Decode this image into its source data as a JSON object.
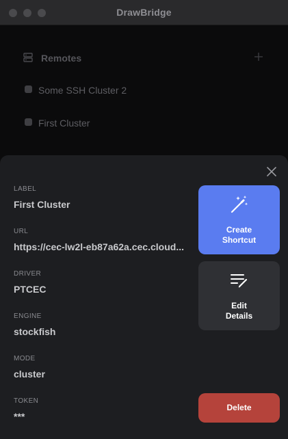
{
  "window": {
    "title": "DrawBridge"
  },
  "remotes": {
    "header": "Remotes",
    "items": [
      {
        "label": "Some SSH Cluster 2"
      },
      {
        "label": "First Cluster"
      }
    ]
  },
  "details": {
    "fields": [
      {
        "label": "LABEL",
        "value": "First Cluster"
      },
      {
        "label": "URL",
        "value": "https://cec-lw2l-eb87a62a.cec.cloud..."
      },
      {
        "label": "DRIVER",
        "value": "PTCEC"
      },
      {
        "label": "ENGINE",
        "value": "stockfish"
      },
      {
        "label": "MODE",
        "value": "cluster"
      },
      {
        "label": "TOKEN",
        "value": "***"
      }
    ],
    "actions": {
      "create_line1": "Create",
      "create_line2": "Shortcut",
      "edit_line1": "Edit",
      "edit_line2": "Details",
      "delete": "Delete"
    }
  },
  "icons": {
    "close": "close-icon",
    "create": "magic-wand-icon",
    "edit": "edit-lines-icon",
    "server": "server-icon",
    "plus": "plus-icon"
  },
  "colors": {
    "accent": "#5a7cf0",
    "danger": "#b5433b",
    "sheet": "#1d1e21",
    "secondary_button": "#2f3034"
  }
}
